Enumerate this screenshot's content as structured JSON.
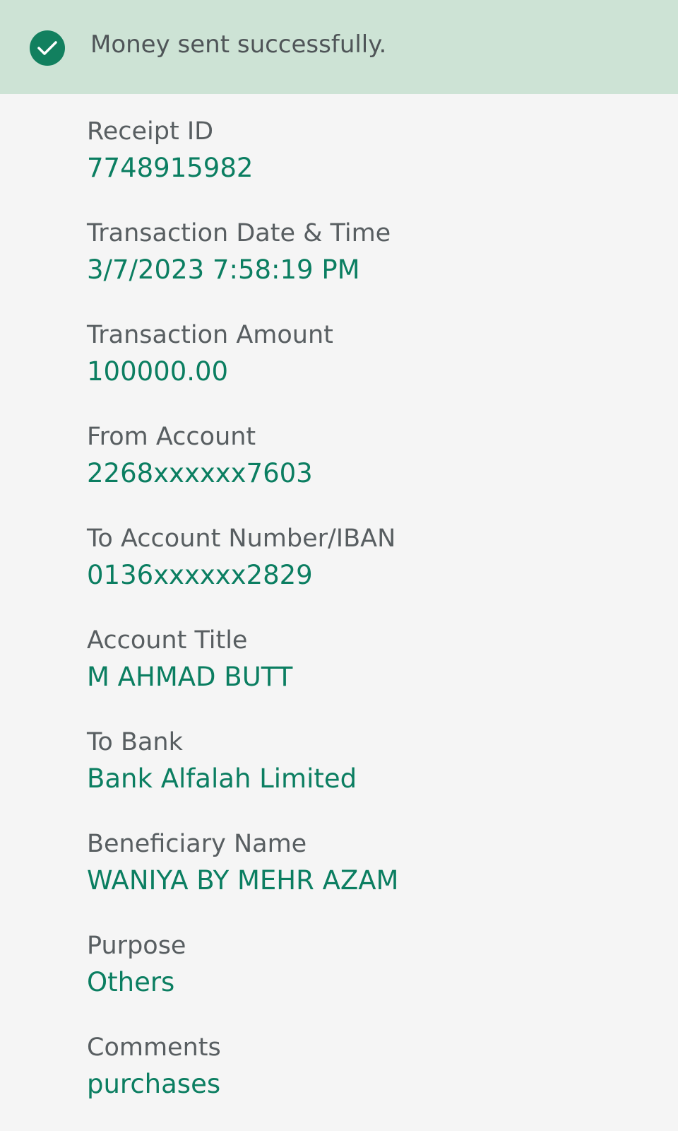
{
  "banner": {
    "message": "Money sent successfully.",
    "icon": "check-circle-icon",
    "background_color": "#cde3d5",
    "icon_color": "#12805f"
  },
  "fields": [
    {
      "label": "Receipt ID",
      "value": "7748915982"
    },
    {
      "label": "Transaction Date & Time",
      "value": "3/7/2023 7:58:19 PM"
    },
    {
      "label": "Transaction Amount",
      "value": "100000.00"
    },
    {
      "label": "From Account",
      "value": "2268xxxxxx7603"
    },
    {
      "label": "To Account Number/IBAN",
      "value": "0136xxxxxx2829"
    },
    {
      "label": "Account Title",
      "value": "M AHMAD BUTT"
    },
    {
      "label": "To Bank",
      "value": "Bank Alfalah Limited"
    },
    {
      "label": "Beneficiary Name",
      "value": "WANIYA BY MEHR AZAM"
    },
    {
      "label": "Purpose",
      "value": "Others"
    },
    {
      "label": "Comments",
      "value": "purchases"
    }
  ],
  "colors": {
    "label": "#585e61",
    "value": "#0b7e61",
    "page_background": "#f5f5f5"
  }
}
